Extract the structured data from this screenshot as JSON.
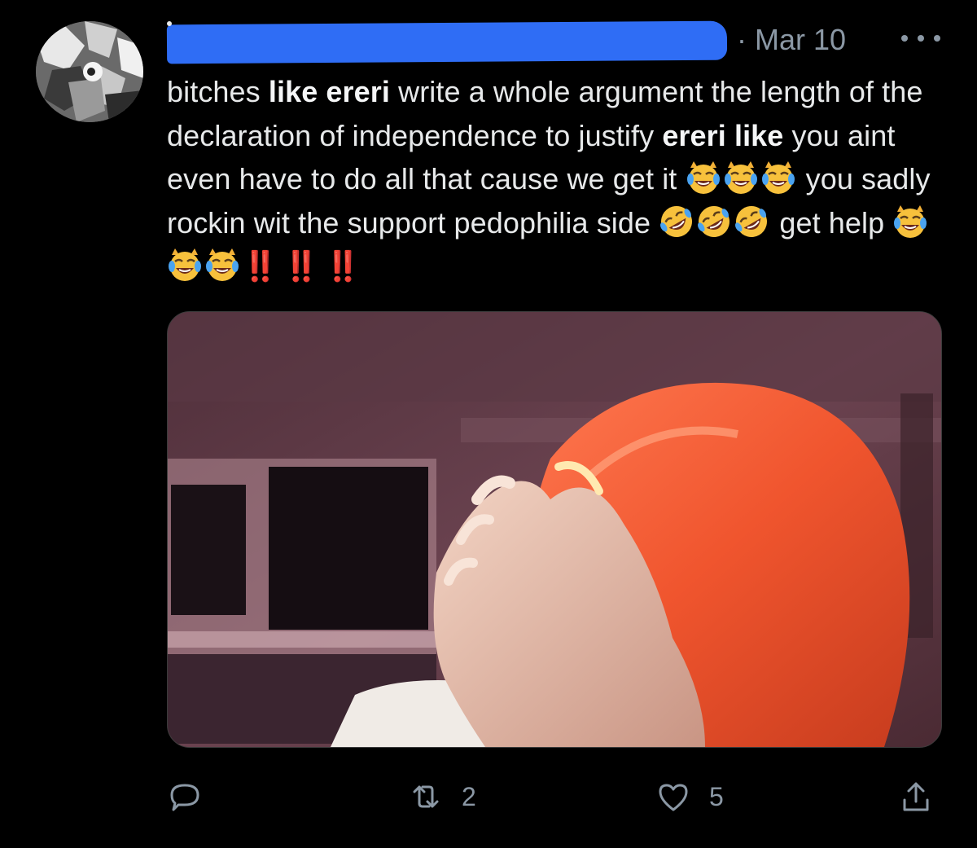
{
  "tweet": {
    "date": "· Mar 10",
    "text": {
      "seg1": "bitches ",
      "seg2_bold": "like ereri",
      "seg3": " write a whole argument the length of the declaration of independence to justify ",
      "seg4_bold": "ereri like",
      "seg5": " you aint even have to do all that cause we get it ",
      "seg6": " you sadly rockin wit the support pedophilia side ",
      "seg7": " get help ",
      "bangs": "‼️ ‼️ ‼️"
    },
    "emoji": {
      "group1": [
        "crying-laughing-cat",
        "crying-laughing-cat",
        "crying-laughing-cat"
      ],
      "group2": [
        "rolling-on-floor-laughing",
        "rolling-on-floor-laughing",
        "rolling-on-floor-laughing"
      ],
      "group3": [
        "crying-laughing-cat",
        "crying-laughing-cat",
        "crying-laughing-cat"
      ]
    },
    "actions": {
      "reply_count": "",
      "retweet_count": "2",
      "like_count": "5"
    }
  },
  "colors": {
    "background": "#000000",
    "text": "#e7e9ea",
    "secondary_text": "#8b98a5",
    "redaction": "#2f6df5",
    "exclamation": "#ff2d2d",
    "media_border": "#3b3b3b"
  },
  "icons": {
    "more": "more-horizontal-icon",
    "reply": "reply-bubble-icon",
    "retweet": "retweet-icon",
    "like": "heart-icon",
    "share": "share-upload-icon"
  }
}
